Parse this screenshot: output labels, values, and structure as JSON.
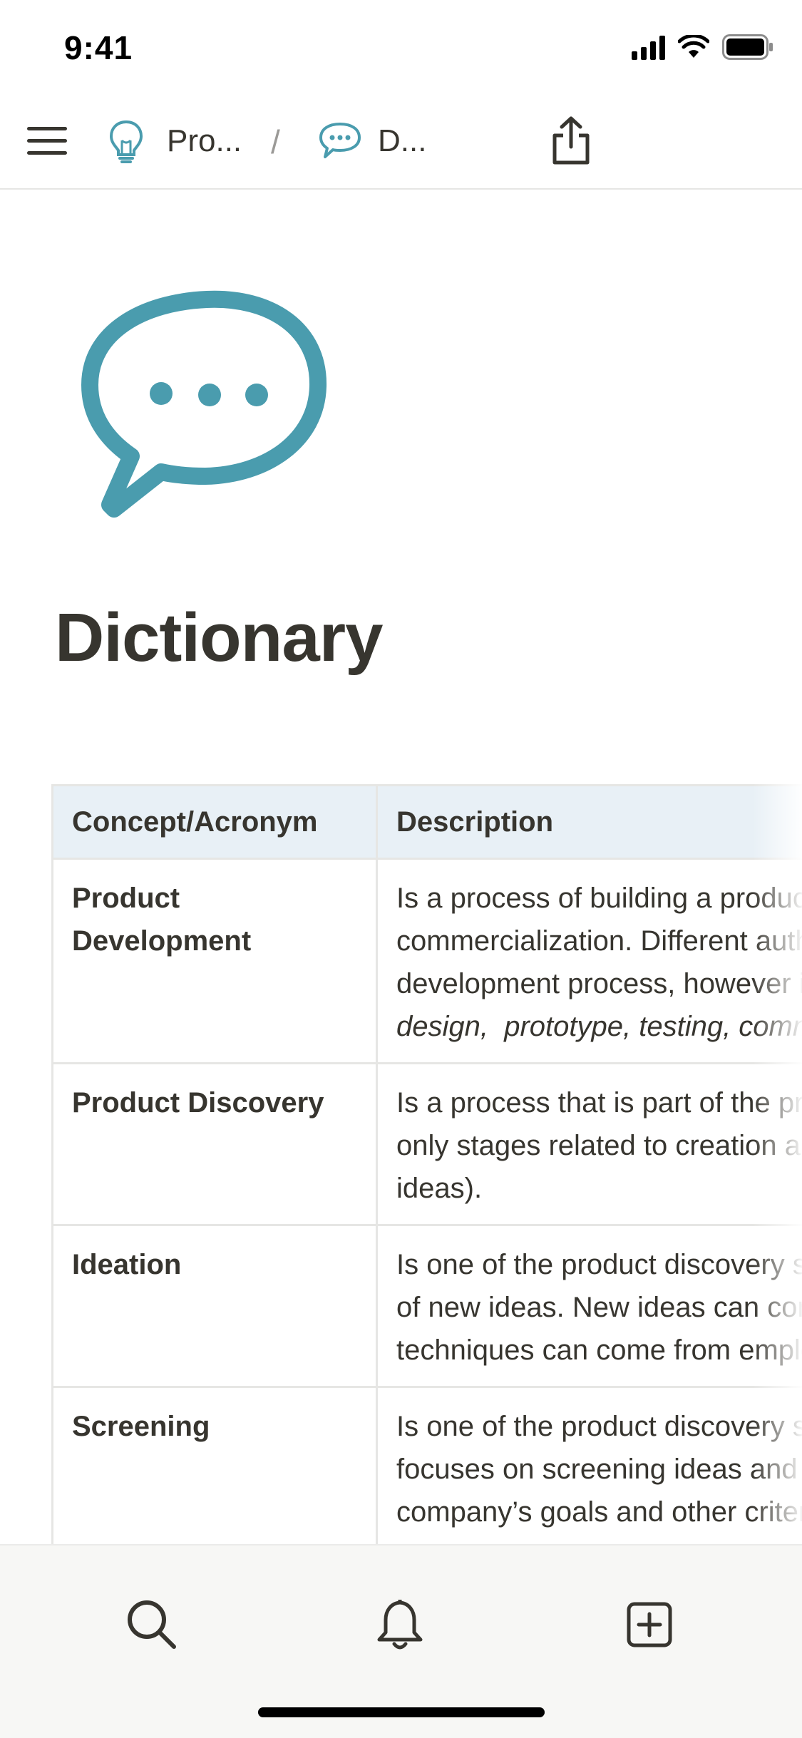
{
  "status_bar": {
    "time": "9:41"
  },
  "nav": {
    "breadcrumb": [
      {
        "label": "Pro...",
        "icon": "lightbulb-icon"
      },
      {
        "label": "D...",
        "icon": "speech-bubble-icon"
      }
    ],
    "separator": "/"
  },
  "page": {
    "icon": "speech-bubble-icon",
    "title": "Dictionary"
  },
  "table": {
    "headers": [
      "Concept/Acronym",
      "Description"
    ],
    "rows": [
      {
        "concept": "Product Development",
        "description_lines": [
          "Is a process of building a product from the idea to its",
          "commercialization. Different authors define the product",
          "development process, however its stages most often include:"
        ],
        "description_italic": "design,  prototype, testing, commercialization."
      },
      {
        "concept": "Product Discovery",
        "description_lines": [
          "Is a process that is part of the product development, but it covers",
          "only stages related to creation and validation of new ideas (only",
          "ideas)."
        ]
      },
      {
        "concept": "Ideation",
        "description_lines": [
          "Is one of the product discovery stages that focuses on generation",
          "of new ideas. New ideas can come from various sources, and",
          "techniques can come from employees, customers and partners."
        ]
      },
      {
        "concept": "Screening",
        "description_lines": [
          "Is one of the product discovery stages. This stage",
          "focuses on screening ideas and evaluating them against the",
          "company’s goals and other criteria."
        ]
      }
    ]
  },
  "bottom_bar": {
    "tabs": [
      {
        "icon": "search-icon"
      },
      {
        "icon": "bell-icon"
      },
      {
        "icon": "add-page-icon"
      }
    ]
  },
  "colors": {
    "accent": "#4a9cae",
    "text": "#37352f",
    "header_bg": "#e8f0f6",
    "bottom_bar_bg": "#f7f7f5"
  }
}
